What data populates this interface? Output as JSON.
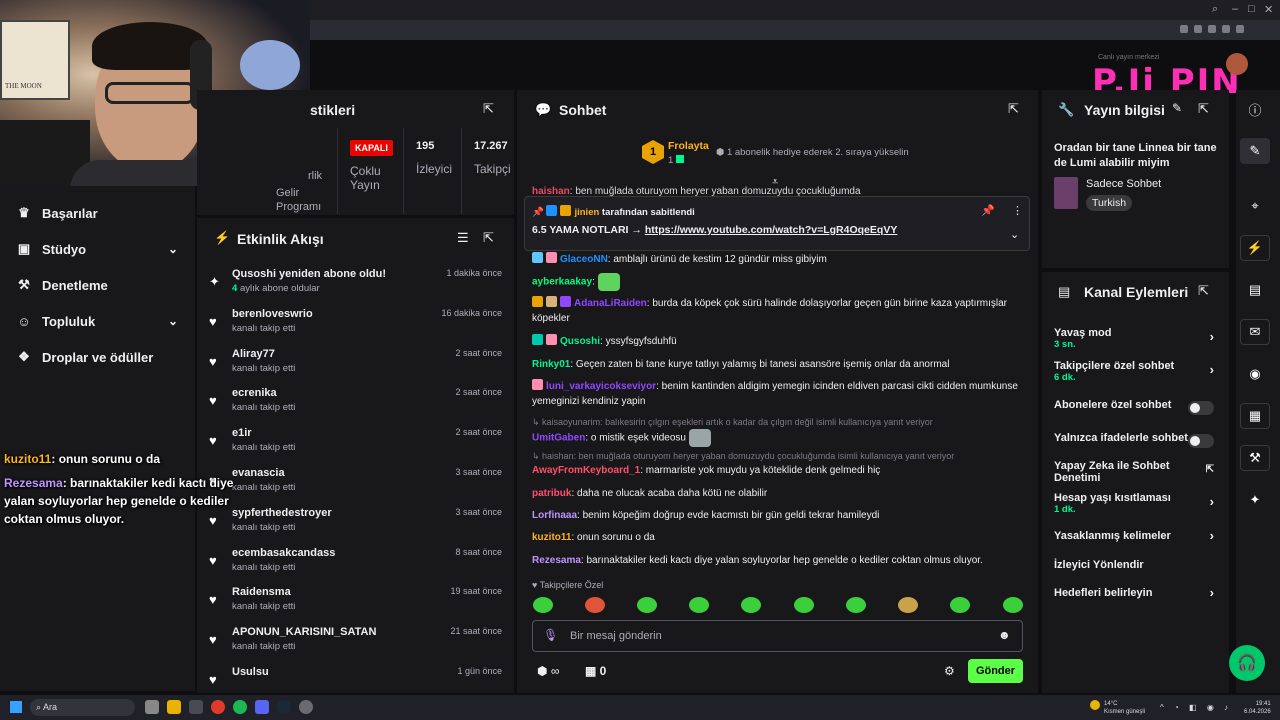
{
  "browser": {
    "controls": [
      "⌕",
      "–",
      "□",
      "✕"
    ]
  },
  "webcam": {
    "poster_text": "THE MOON"
  },
  "logo": {
    "text": "P.Ji PIN",
    "caption": "Canlı yayın merkezi"
  },
  "left_nav": {
    "items": [
      {
        "icon": "♛",
        "label": "Başarılar",
        "chevron": ""
      },
      {
        "icon": "▣",
        "label": "Stüdyo",
        "chevron": "⌄"
      },
      {
        "icon": "⚒",
        "label": "Denetleme",
        "chevron": ""
      },
      {
        "icon": "☺",
        "label": "Topluluk",
        "chevron": "⌄"
      },
      {
        "icon": "❖",
        "label": "Droplar ve ödüller",
        "chevron": ""
      }
    ]
  },
  "stream_overlay": [
    {
      "user": "kuzito11",
      "text": ": onun sorunu o da"
    },
    {
      "user": "Rezesama",
      "text": ": barınaktakiler kedi kactı diye yalan soyluyorlar hep genelde o kediler coktan olmus oluyor."
    }
  ],
  "stats_panel": {
    "title": "stikleri",
    "items": [
      {
        "value": "",
        "label": "Gelir Programı",
        "pre": "rlik"
      },
      {
        "value": "KAPALI",
        "label": "Çoklu Yayın"
      },
      {
        "value": "195",
        "label": "İzleyici"
      },
      {
        "value": "17.267",
        "label": "Takipçi"
      }
    ]
  },
  "activity": {
    "title": "Etkinlik Akışı",
    "items": [
      {
        "icon": "✦",
        "name": "Qusoshi yeniden abone oldu!",
        "sub_highlight": "4",
        "sub": "aylık abone oldular",
        "time": "1 dakika önce"
      },
      {
        "icon": "♥",
        "name": "berenloveswrio",
        "sub": "kanalı takip etti",
        "time": "16 dakika önce"
      },
      {
        "icon": "♥",
        "name": "Aliray77",
        "sub": "kanalı takip etti",
        "time": "2 saat önce"
      },
      {
        "icon": "♥",
        "name": "ecrenika",
        "sub": "kanalı takip etti",
        "time": "2 saat önce"
      },
      {
        "icon": "♥",
        "name": "e1ir",
        "sub": "kanalı takip etti",
        "time": "2 saat önce"
      },
      {
        "icon": "♥",
        "name": "evanascia",
        "sub": "kanalı takip etti",
        "time": "3 saat önce"
      },
      {
        "icon": "♥",
        "name": "sypferthedestroyer",
        "sub": "kanalı takip etti",
        "time": "3 saat önce"
      },
      {
        "icon": "♥",
        "name": "ecembasakcandass",
        "sub": "kanalı takip etti",
        "time": "8 saat önce"
      },
      {
        "icon": "♥",
        "name": "Raidensma",
        "sub": "kanalı takip etti",
        "time": "19 saat önce"
      },
      {
        "icon": "♥",
        "name": "APONUN_KARISINI_SATAN",
        "sub": "kanalı takip etti",
        "time": "21 saat önce"
      },
      {
        "icon": "♥",
        "name": "Usulsu",
        "sub": "",
        "time": "1 gün önce"
      }
    ]
  },
  "chat": {
    "title": "Sohbet",
    "leader": {
      "name": "Frolayta",
      "rank": "1",
      "count": "1"
    },
    "gift_hint": "1 abonelik hediye ederek 2. sıraya yükselin",
    "cutoff_line": {
      "user": "haishan",
      "text": ": ben muğlada oturuyom heryer yaban domuzuydu çocukluğumda"
    },
    "pinned": {
      "by": "jinien",
      "by_suffix": "tarafından sabitlendi",
      "text": "6.5 YAMA NOTLARI → ",
      "link": "https://www.youtube.com/watch?v=LgR4OqeEqVY"
    },
    "messages": [
      {
        "user": "GlaceoNN",
        "color": "#1e90ff",
        "text": ": amblajlı ürünü de kestim 12 gündür miss gibiyim"
      },
      {
        "user": "ayberkaakay",
        "color": "#00ff7f",
        "text": ":"
      },
      {
        "user": "AdanaLiRaiden",
        "color": "#9147ff",
        "text": ": burda da köpek çok sürü halinde dolaşıyorlar geçen gün birine kaza yaptırmışlar köpekler"
      },
      {
        "user": "Qusoshi",
        "color": "#00f593",
        "text": ": yssyfsgyfsduhfü"
      },
      {
        "user": "Rinky01",
        "color": "#00f593",
        "text": ": Geçen zaten bi tane kurye tatlıyı yalamış bi tanesi asansöre işemiş onlar da anormal"
      },
      {
        "user": "luni_varkayicokseviyor",
        "color": "#9147ff",
        "text": ": benim kantinden aldigim yemegin icinden eldiven parcasi cikti cidden mumkunse yemeginizi kendiniz yapin"
      },
      {
        "reply": "↳ kaisaoyunarim: balıkesirin çılgın eşekleri artık o kadar da çılgın değil isimli kullanıcıya yanıt veriyor"
      },
      {
        "user": "UmitGaben",
        "color": "#9147ff",
        "text": ": o mistik eşek videosu"
      },
      {
        "reply": "↳ haishan: ben muğlada oturuyom heryer yaban domuzuydu çocukluğumda isimli kullanıcıya yanıt veriyor"
      },
      {
        "user": "AwayFromKeyboard_1",
        "color": "#ff4f6d",
        "text": ": marmariste yok muydu ya köteklide denk gelmedi hiç"
      },
      {
        "user": "patribuk",
        "color": "#ff4f6d",
        "text": ": daha ne olucak acaba daha kötü ne olabilir"
      },
      {
        "user": "Lorfinaaa",
        "color": "#bf94ff",
        "text": ": benim köpeğim doğrup evde kacmıstı bir gün geldi tekrar hamileydi"
      },
      {
        "user": "kuzito11",
        "color": "#ffb31a",
        "text": ": onun sorunu o da"
      },
      {
        "user": "Rezesama",
        "color": "#bf94ff",
        "text": ": barınaktakiler kedi kactı diye yalan soyluyorlar hep genelde o kediler coktan olmus oluyor."
      }
    ],
    "followers_only": "Takipçilere Özel",
    "input_placeholder": "Bir mesaj gönderin",
    "points": "∞",
    "drops": "0",
    "send_label": "Gönder"
  },
  "stream_info": {
    "title": "Yayın bilgisi",
    "description": "Oradan bir tane Linnea bir tane de Lumi alabilir miyim",
    "category": "Sadece Sohbet",
    "tag": "Turkish"
  },
  "channel_actions": {
    "title": "Kanal Eylemleri",
    "items": [
      {
        "label": "Yavaş mod",
        "sub": "3 sn.",
        "control": "chevron"
      },
      {
        "label": "Takipçilere özel sohbet",
        "sub": "6 dk.",
        "control": "chevron"
      },
      {
        "label": "Abonelere özel sohbet",
        "sub": "",
        "control": "toggle"
      },
      {
        "label": "Yalnızca ifadelerle sohbet",
        "sub": "",
        "control": "toggle"
      },
      {
        "label": "Yapay Zeka ile Sohbet Denetimi",
        "sub": "",
        "control": "external"
      },
      {
        "label": "Hesap yaşı kısıtlaması",
        "sub": "1 dk.",
        "control": "chevron"
      },
      {
        "label": "Yasaklanmış kelimeler",
        "sub": "",
        "control": "chevron"
      },
      {
        "label": "İzleyici Yönlendir",
        "sub": "",
        "control": "none"
      },
      {
        "label": "Hedefleri belirleyin",
        "sub": "",
        "control": "chevron"
      }
    ]
  },
  "right_sidebar": [
    "ⓘ",
    "✎",
    "⌖",
    "⚡",
    "▤",
    "✉",
    "◉",
    "▦",
    "⚒",
    "✦"
  ],
  "taskbar": {
    "search": "Ara",
    "weather_temp": "14°C",
    "weather_desc": "Kısmen güneşli",
    "time": "19:41",
    "date": "6.04.2026"
  },
  "colors": {
    "accent": "#9147ff",
    "green": "#00f593",
    "send": "#5cff47",
    "live_red": "#eb0400"
  }
}
